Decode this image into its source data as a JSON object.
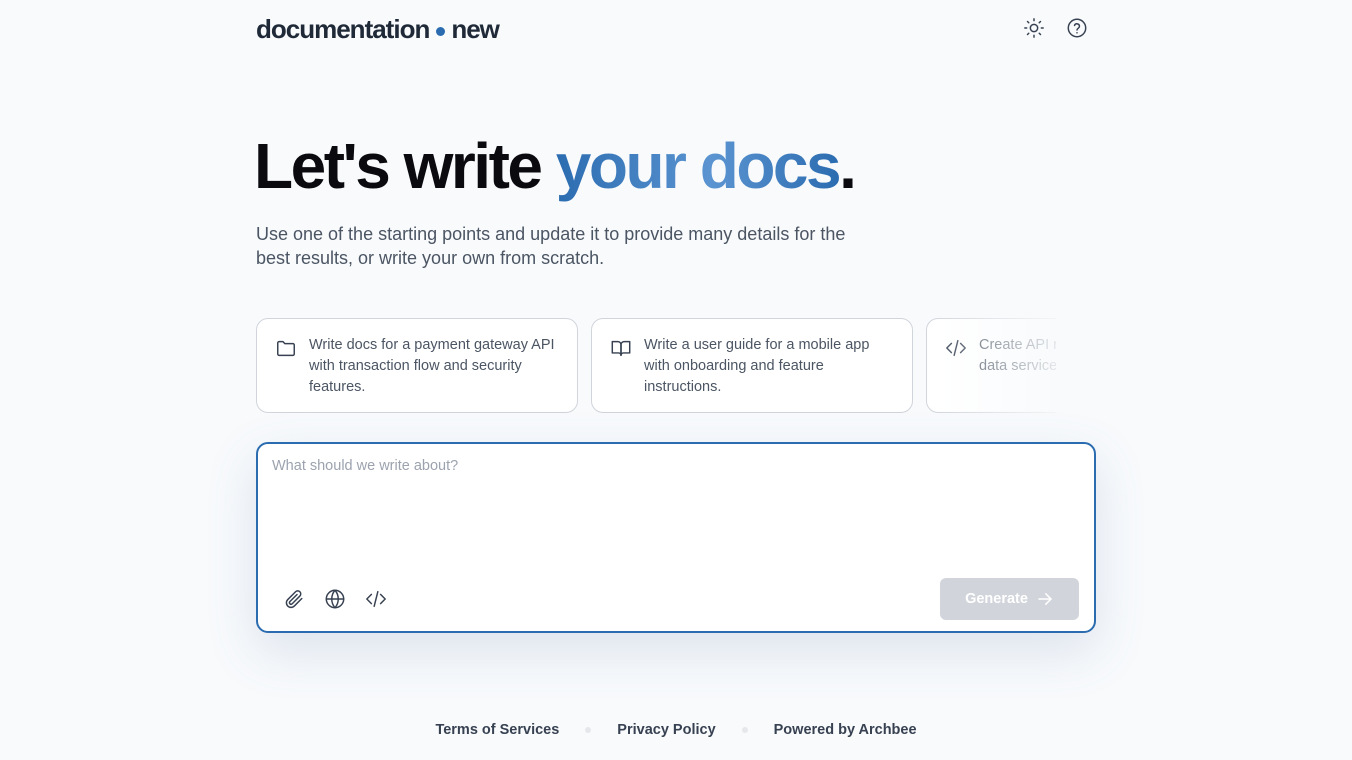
{
  "header": {
    "logo_left": "documentation",
    "logo_right": "new",
    "theme_icon": "sun-icon",
    "help_icon": "help-circle-icon"
  },
  "hero": {
    "title_start": "Let's write ",
    "title_accent": "your docs",
    "title_end": ".",
    "subtitle": "Use one of the starting points and update it to provide many details for the best results, or write your own from scratch."
  },
  "prompts": [
    {
      "icon": "folder-icon",
      "text": "Write docs for a payment gateway API with transaction flow and security features."
    },
    {
      "icon": "book-open-icon",
      "text": "Write a user guide for a mobile app with onboarding and feature instructions."
    },
    {
      "icon": "code-icon",
      "text": "Create API reference for a weather data service with authentication"
    }
  ],
  "composer": {
    "placeholder": "What should we write about?",
    "value": "",
    "tools": [
      "paperclip-icon",
      "globe-icon",
      "code-icon"
    ],
    "generate_label": "Generate",
    "generate_enabled": false
  },
  "footer": {
    "links": [
      "Terms of Services",
      "Privacy Policy",
      "Powered by Archbee"
    ]
  },
  "colors": {
    "accent": "#2b6cb0",
    "background": "#f8fafc",
    "button_disabled": "#d1d5db"
  }
}
